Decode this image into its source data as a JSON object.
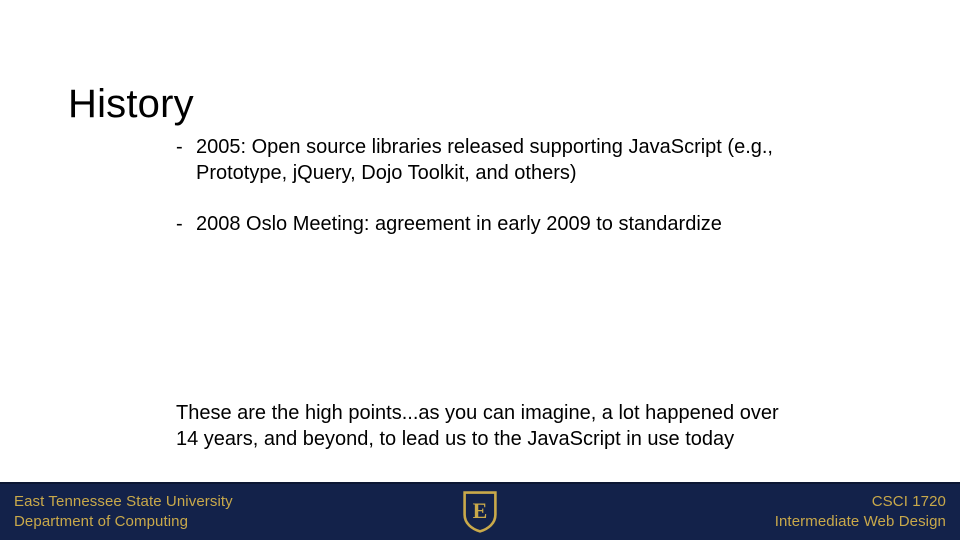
{
  "slide": {
    "title": "History",
    "bullets": [
      {
        "marker": "-",
        "text": "2005: Open source libraries released supporting JavaScript (e.g., Prototype, jQuery, Dojo Toolkit, and others)"
      },
      {
        "marker": "-",
        "text": "2008 Oslo Meeting: agreement in early 2009 to standardize"
      }
    ],
    "closing_paragraph": "These are the high points...as you can imagine, a lot happened over 14 years, and beyond, to lead us to the JavaScript in use today"
  },
  "footer": {
    "left_line1": "East Tennessee State University",
    "left_line2": "Department of Computing",
    "right_line1": "CSCI 1720",
    "right_line2": "Intermediate Web Design",
    "logo": {
      "name": "etsu-shield-logo",
      "letter": "E"
    },
    "colors": {
      "background": "#13224A",
      "text": "#C9A94A",
      "shield_fill": "#13224A",
      "shield_border": "#C9A94A"
    }
  }
}
